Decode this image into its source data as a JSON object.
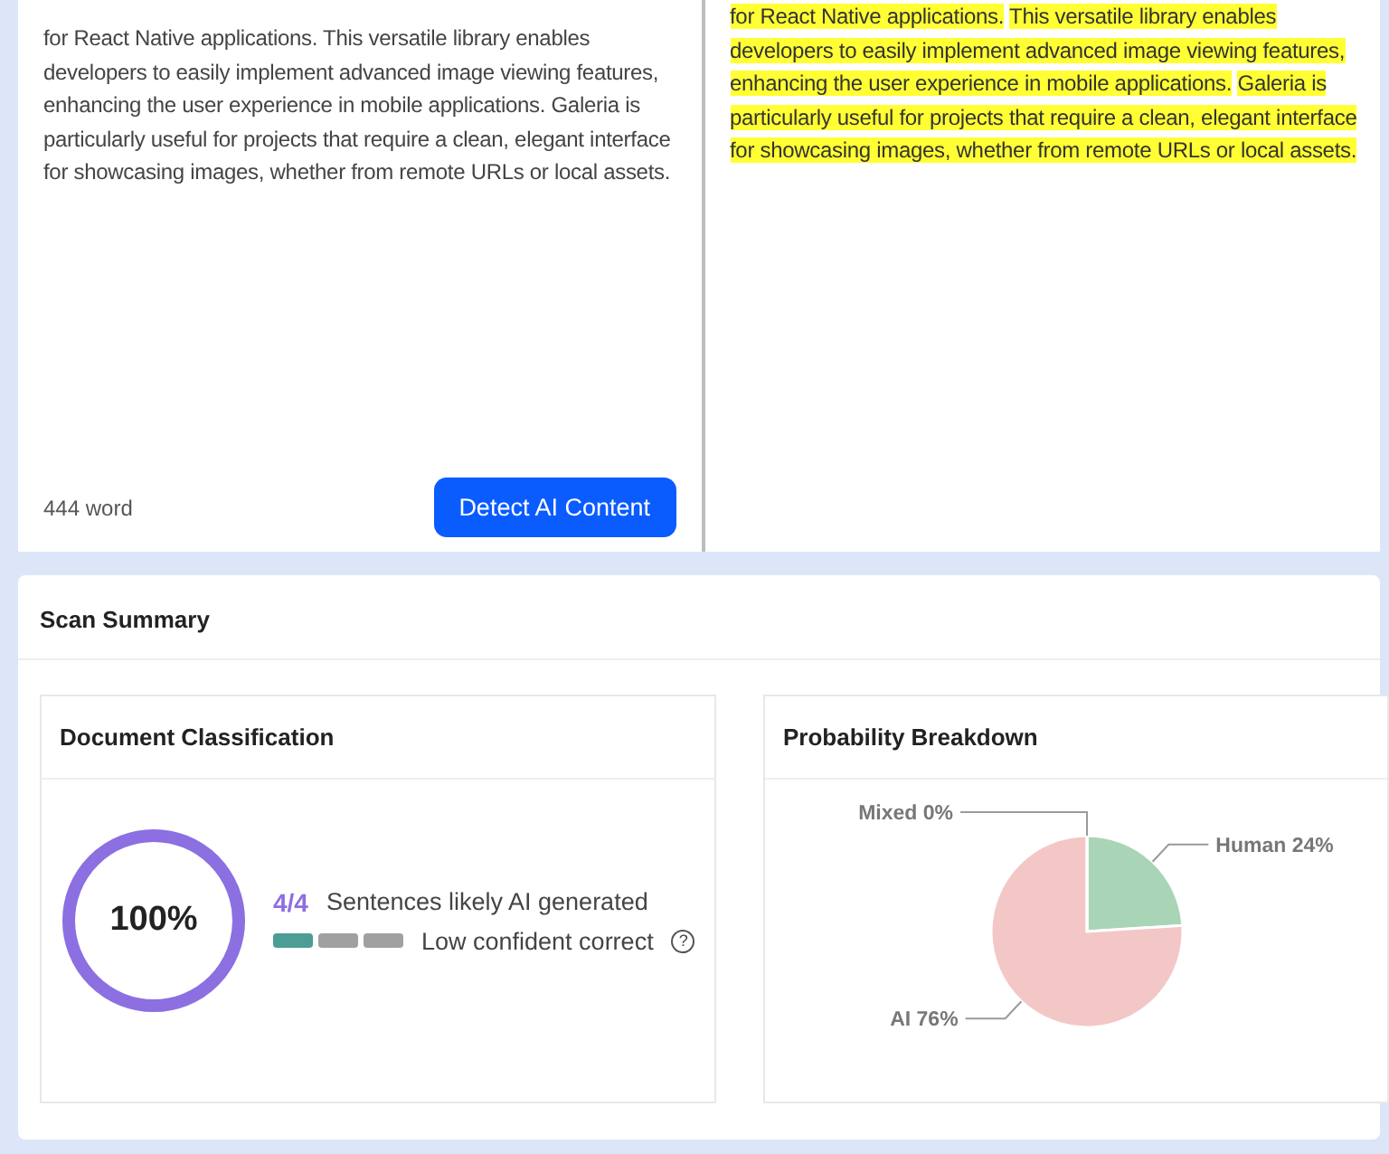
{
  "editor": {
    "text": "for React Native applications. This versatile library enables developers to easily implement advanced image viewing features, enhancing the user experience in mobile applications. Galeria is particularly useful for projects that require a clean, elegant interface for showcasing images, whether from remote URLs or local assets.",
    "word_count": "444 word",
    "button": "Detect AI Content"
  },
  "result": {
    "sentences": [
      {
        "text": "for React Native applications.",
        "highlighted": true
      },
      {
        "text": "This versatile library enables developers to easily implement advanced image viewing features, enhancing the user experience in mobile applications.",
        "highlighted": true
      },
      {
        "text": "Galeria is particularly useful for projects that require a clean, elegant interface for showcasing images, whether from remote URLs or local assets.",
        "highlighted": true
      }
    ]
  },
  "scan_summary": {
    "title": "Scan Summary",
    "classification": {
      "title": "Document Classification",
      "percent": "100%",
      "level": 1.0,
      "count": "4/4",
      "count_label": "Sentences likely AI generated",
      "confidence_segments": [
        {
          "on": true
        },
        {
          "on": false
        },
        {
          "on": false
        }
      ],
      "confidence_label": "Low confident correct",
      "help": "?"
    },
    "probability": {
      "title": "Probability Breakdown",
      "chart_data": {
        "type": "pie",
        "categories": [
          "Human",
          "AI",
          "Mixed"
        ],
        "values": [
          24,
          76,
          0
        ],
        "colors": [
          "#a9d4b6",
          "#f4c7c7",
          "#ffffff"
        ],
        "value_labels": [
          "24%",
          "76%",
          "0%"
        ]
      }
    }
  }
}
